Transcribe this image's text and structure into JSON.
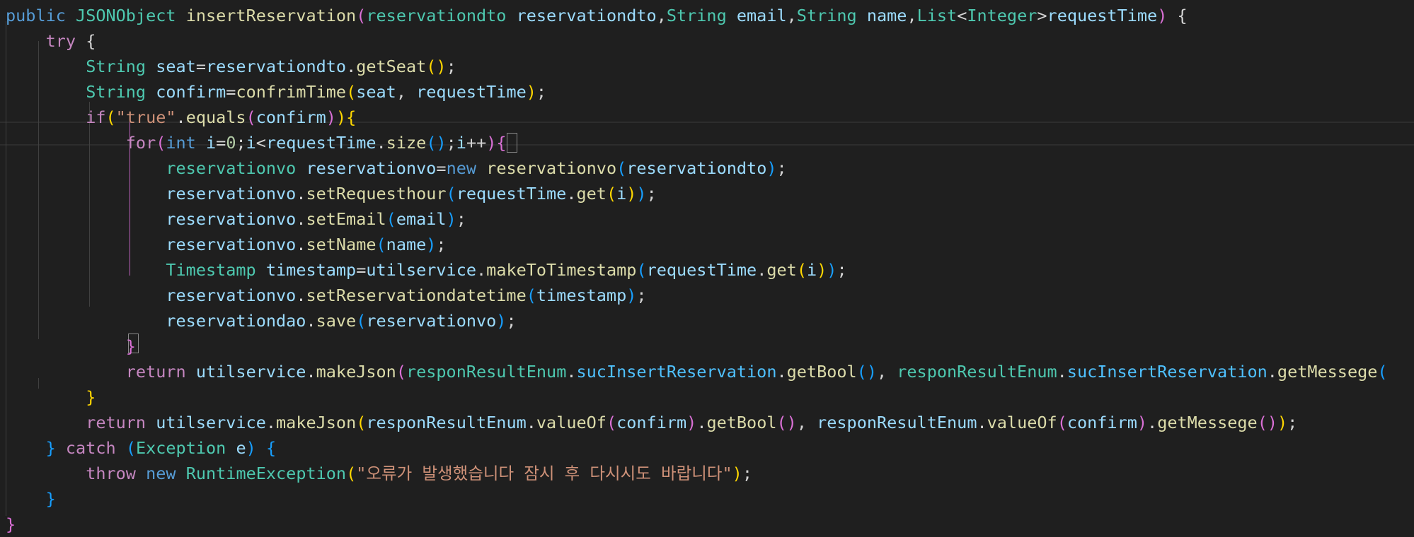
{
  "editor": {
    "language": "java",
    "lines": [
      [
        [
          "k",
          "public "
        ],
        [
          "t",
          "JSONObject"
        ],
        [
          "d",
          " "
        ],
        [
          "f",
          "insertReservation"
        ],
        [
          "pp",
          "("
        ],
        [
          "t",
          "reservationdto"
        ],
        [
          "d",
          " "
        ],
        [
          "v",
          "reservationdto"
        ],
        [
          "d",
          ","
        ],
        [
          "t",
          "String"
        ],
        [
          "d",
          " "
        ],
        [
          "v",
          "email"
        ],
        [
          "d",
          ","
        ],
        [
          "t",
          "String"
        ],
        [
          "d",
          " "
        ],
        [
          "v",
          "name"
        ],
        [
          "d",
          ","
        ],
        [
          "t",
          "List"
        ],
        [
          "d",
          "<"
        ],
        [
          "t",
          "Integer"
        ],
        [
          "d",
          ">"
        ],
        [
          "v",
          "requestTime"
        ],
        [
          "pp",
          ")"
        ],
        [
          "d",
          " {"
        ]
      ],
      [
        [
          "d",
          "    "
        ],
        [
          "c",
          "try"
        ],
        [
          "d",
          " {"
        ]
      ],
      [
        [
          "d",
          "        "
        ],
        [
          "t",
          "String"
        ],
        [
          "d",
          " "
        ],
        [
          "v",
          "seat"
        ],
        [
          "d",
          "="
        ],
        [
          "v",
          "reservationdto"
        ],
        [
          "d",
          "."
        ],
        [
          "f",
          "getSeat"
        ],
        [
          "pg",
          "()"
        ],
        [
          "d",
          ";"
        ]
      ],
      [
        [
          "d",
          "        "
        ],
        [
          "t",
          "String"
        ],
        [
          "d",
          " "
        ],
        [
          "v",
          "confirm"
        ],
        [
          "d",
          "="
        ],
        [
          "f",
          "confrimTime"
        ],
        [
          "pg",
          "("
        ],
        [
          "v",
          "seat"
        ],
        [
          "d",
          ", "
        ],
        [
          "v",
          "requestTime"
        ],
        [
          "pg",
          ")"
        ],
        [
          "d",
          ";"
        ]
      ],
      [
        [
          "d",
          "        "
        ],
        [
          "c",
          "if"
        ],
        [
          "pg",
          "("
        ],
        [
          "s",
          "\"true\""
        ],
        [
          "d",
          "."
        ],
        [
          "f",
          "equals"
        ],
        [
          "pp",
          "("
        ],
        [
          "v",
          "confirm"
        ],
        [
          "pp",
          ")"
        ],
        [
          "pg",
          ")"
        ],
        [
          "p",
          "{"
        ]
      ],
      [
        [
          "d",
          "            "
        ],
        [
          "c",
          "for"
        ],
        [
          "pp",
          "("
        ],
        [
          "k",
          "int"
        ],
        [
          "d",
          " "
        ],
        [
          "v",
          "i"
        ],
        [
          "d",
          "="
        ],
        [
          "n",
          "0"
        ],
        [
          "d",
          ";"
        ],
        [
          "v",
          "i"
        ],
        [
          "d",
          "<"
        ],
        [
          "v",
          "requestTime"
        ],
        [
          "d",
          "."
        ],
        [
          "f",
          "size"
        ],
        [
          "pb",
          "()"
        ],
        [
          "d",
          ";"
        ],
        [
          "v",
          "i"
        ],
        [
          "d",
          "++"
        ],
        [
          "pp",
          ")"
        ],
        [
          "pp",
          "{"
        ]
      ],
      [
        [
          "d",
          "                "
        ],
        [
          "t",
          "reservationvo"
        ],
        [
          "d",
          " "
        ],
        [
          "v",
          "reservationvo"
        ],
        [
          "d",
          "="
        ],
        [
          "k",
          "new"
        ],
        [
          "d",
          " "
        ],
        [
          "f",
          "reservationvo"
        ],
        [
          "pb",
          "("
        ],
        [
          "v",
          "reservationdto"
        ],
        [
          "pb",
          ")"
        ],
        [
          "d",
          ";"
        ]
      ],
      [
        [
          "d",
          "                "
        ],
        [
          "v",
          "reservationvo"
        ],
        [
          "d",
          "."
        ],
        [
          "f",
          "setRequesthour"
        ],
        [
          "pb",
          "("
        ],
        [
          "v",
          "requestTime"
        ],
        [
          "d",
          "."
        ],
        [
          "f",
          "get"
        ],
        [
          "pg",
          "("
        ],
        [
          "v",
          "i"
        ],
        [
          "pg",
          ")"
        ],
        [
          "pb",
          ")"
        ],
        [
          "d",
          ";"
        ]
      ],
      [
        [
          "d",
          "                "
        ],
        [
          "v",
          "reservationvo"
        ],
        [
          "d",
          "."
        ],
        [
          "f",
          "setEmail"
        ],
        [
          "pb",
          "("
        ],
        [
          "v",
          "email"
        ],
        [
          "pb",
          ")"
        ],
        [
          "d",
          ";"
        ]
      ],
      [
        [
          "d",
          "                "
        ],
        [
          "v",
          "reservationvo"
        ],
        [
          "d",
          "."
        ],
        [
          "f",
          "setName"
        ],
        [
          "pb",
          "("
        ],
        [
          "v",
          "name"
        ],
        [
          "pb",
          ")"
        ],
        [
          "d",
          ";"
        ]
      ],
      [
        [
          "d",
          "                "
        ],
        [
          "t",
          "Timestamp"
        ],
        [
          "d",
          " "
        ],
        [
          "v",
          "timestamp"
        ],
        [
          "d",
          "="
        ],
        [
          "v",
          "utilservice"
        ],
        [
          "d",
          "."
        ],
        [
          "f",
          "makeToTimestamp"
        ],
        [
          "pb",
          "("
        ],
        [
          "v",
          "requestTime"
        ],
        [
          "d",
          "."
        ],
        [
          "f",
          "get"
        ],
        [
          "pg",
          "("
        ],
        [
          "v",
          "i"
        ],
        [
          "pg",
          ")"
        ],
        [
          "pb",
          ")"
        ],
        [
          "d",
          ";"
        ]
      ],
      [
        [
          "d",
          "                "
        ],
        [
          "v",
          "reservationvo"
        ],
        [
          "d",
          "."
        ],
        [
          "f",
          "setReservationdatetime"
        ],
        [
          "pb",
          "("
        ],
        [
          "v",
          "timestamp"
        ],
        [
          "pb",
          ")"
        ],
        [
          "d",
          ";"
        ]
      ],
      [
        [
          "d",
          "                "
        ],
        [
          "v",
          "reservationdao"
        ],
        [
          "d",
          "."
        ],
        [
          "f",
          "save"
        ],
        [
          "pb",
          "("
        ],
        [
          "v",
          "reservationvo"
        ],
        [
          "pb",
          ")"
        ],
        [
          "d",
          ";"
        ]
      ],
      [
        [
          "d",
          "            "
        ],
        [
          "pp",
          "}"
        ]
      ],
      [
        [
          "d",
          "            "
        ],
        [
          "c",
          "return"
        ],
        [
          "d",
          " "
        ],
        [
          "v",
          "utilservice"
        ],
        [
          "d",
          "."
        ],
        [
          "f",
          "makeJson"
        ],
        [
          "pp",
          "("
        ],
        [
          "t",
          "responResultEnum"
        ],
        [
          "d",
          "."
        ],
        [
          "e",
          "sucInsertReservation"
        ],
        [
          "d",
          "."
        ],
        [
          "f",
          "getBool"
        ],
        [
          "pb",
          "()"
        ],
        [
          "d",
          ", "
        ],
        [
          "t",
          "responResultEnum"
        ],
        [
          "d",
          "."
        ],
        [
          "e",
          "sucInsertReservation"
        ],
        [
          "d",
          "."
        ],
        [
          "f",
          "getMessege"
        ],
        [
          "pb",
          "("
        ]
      ],
      [
        [
          "d",
          "        "
        ],
        [
          "p",
          "}"
        ]
      ],
      [
        [
          "d",
          "        "
        ],
        [
          "c",
          "return"
        ],
        [
          "d",
          " "
        ],
        [
          "v",
          "utilservice"
        ],
        [
          "d",
          "."
        ],
        [
          "f",
          "makeJson"
        ],
        [
          "pg",
          "("
        ],
        [
          "v",
          "responResultEnum"
        ],
        [
          "d",
          "."
        ],
        [
          "f",
          "valueOf"
        ],
        [
          "pp",
          "("
        ],
        [
          "v",
          "confirm"
        ],
        [
          "pp",
          ")"
        ],
        [
          "d",
          "."
        ],
        [
          "f",
          "getBool"
        ],
        [
          "pp",
          "()"
        ],
        [
          "d",
          ", "
        ],
        [
          "v",
          "responResultEnum"
        ],
        [
          "d",
          "."
        ],
        [
          "f",
          "valueOf"
        ],
        [
          "pp",
          "("
        ],
        [
          "v",
          "confirm"
        ],
        [
          "pp",
          ")"
        ],
        [
          "d",
          "."
        ],
        [
          "f",
          "getMessege"
        ],
        [
          "pp",
          "()"
        ],
        [
          "pg",
          ")"
        ],
        [
          "d",
          ";"
        ]
      ],
      [
        [
          "d",
          "    "
        ],
        [
          "pb",
          "}"
        ],
        [
          "d",
          " "
        ],
        [
          "c",
          "catch"
        ],
        [
          "d",
          " "
        ],
        [
          "pb",
          "("
        ],
        [
          "t",
          "Exception"
        ],
        [
          "d",
          " "
        ],
        [
          "v",
          "e"
        ],
        [
          "pb",
          ")"
        ],
        [
          "d",
          " "
        ],
        [
          "pb",
          "{"
        ]
      ],
      [
        [
          "d",
          "        "
        ],
        [
          "c",
          "throw"
        ],
        [
          "d",
          " "
        ],
        [
          "k",
          "new"
        ],
        [
          "d",
          " "
        ],
        [
          "t",
          "RuntimeException"
        ],
        [
          "pg",
          "("
        ],
        [
          "s",
          "\"오류가 발생했습니다 잠시 후 다시시도 바랍니다\""
        ],
        [
          "pg",
          ")"
        ],
        [
          "d",
          ";"
        ]
      ],
      [
        [
          "d",
          "    "
        ],
        [
          "pb",
          "}"
        ]
      ],
      [
        [
          "pp",
          "}"
        ]
      ]
    ]
  }
}
